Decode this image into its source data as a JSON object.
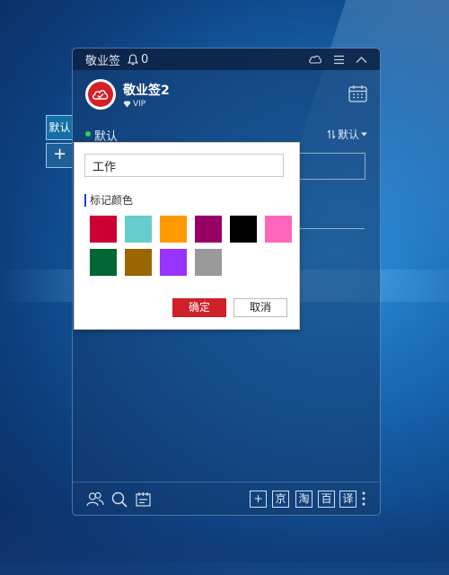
{
  "titlebar": {
    "app_name": "敬业签",
    "notification_count": "0"
  },
  "header": {
    "username": "敬业签2",
    "vip_label": "VIP"
  },
  "groupbar": {
    "group_name": "默认",
    "sort_label": "默认"
  },
  "sidebar": {
    "tab_label": "默认",
    "add_label": "+"
  },
  "dialog": {
    "input_value": "工作",
    "color_title": "标记颜色",
    "colors": [
      "#cc0033",
      "#66cccc",
      "#ff9900",
      "#990066",
      "#000000",
      "#ff66bb",
      "#006633",
      "#996600",
      "#9933ff",
      "#999999"
    ],
    "ok_label": "确定",
    "cancel_label": "取消"
  },
  "bottombar": {
    "add_label": "+",
    "jd_label": "京",
    "taobao_label": "淘",
    "baidu_label": "百",
    "translate_label": "译"
  },
  "icons": {
    "titlebar": [
      "bell-icon",
      "cloud-sync-icon",
      "menu-icon",
      "collapse-icon"
    ],
    "header": [
      "logo-icon",
      "diamond-icon",
      "calendar-icon"
    ],
    "bottombar": [
      "contacts-icon",
      "search-icon",
      "notes-icon",
      "more-icon"
    ]
  }
}
